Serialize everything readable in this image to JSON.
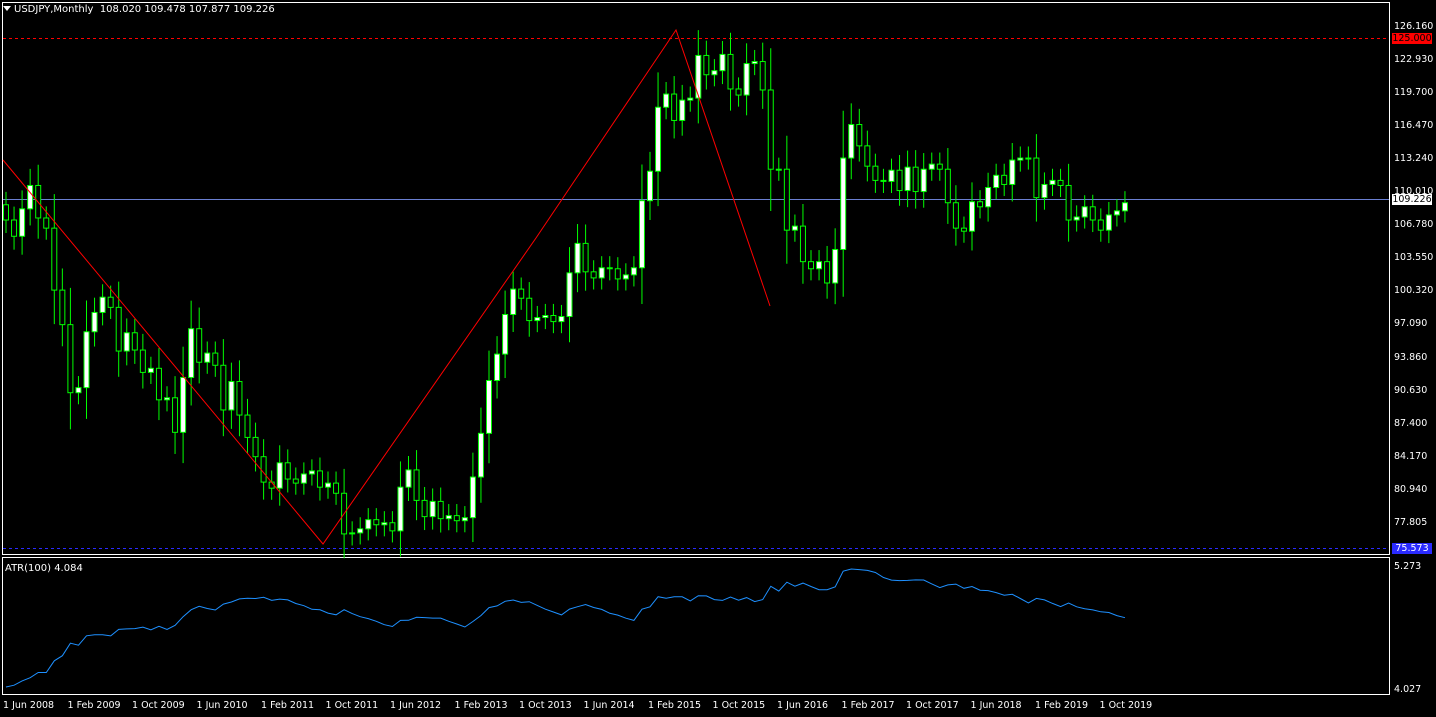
{
  "header": {
    "symbol_timeframe": "USDJPY,Monthly",
    "ohlc": "108.020 109.478 107.877 109.226"
  },
  "main_axis": {
    "ticks": [
      "126.160",
      "122.930",
      "119.700",
      "116.470",
      "113.240",
      "110.010",
      "106.780",
      "103.550",
      "100.320",
      "97.090",
      "93.860",
      "90.630",
      "87.400",
      "84.170",
      "80.940",
      "77.805"
    ]
  },
  "price_tags": {
    "upper_level": "125.000",
    "current": "109.226",
    "lower_level": "75.573"
  },
  "indicator": {
    "label": "ATR(100) 4.084",
    "ticks": [
      "5.273",
      "4.027"
    ]
  },
  "x_axis": {
    "labels": [
      "1 Jun 2008",
      "1 Feb 2009",
      "1 Oct 2009",
      "1 Jun 2010",
      "1 Feb 2011",
      "1 Oct 2011",
      "1 Jun 2012",
      "1 Feb 2013",
      "1 Oct 2013",
      "1 Jun 2014",
      "1 Feb 2015",
      "1 Oct 2015",
      "1 Jun 2016",
      "1 Feb 2017",
      "1 Oct 2017",
      "1 Jun 2018",
      "1 Feb 2019",
      "1 Oct 2019"
    ]
  },
  "colors": {
    "background": "#000000",
    "bull_candle": "#ffffff",
    "wick": "#00ff00",
    "bear_candle": "#000000",
    "zigzag": "#ff0000",
    "atr_line": "#1e90ff",
    "level_line": "#ff0000",
    "current_price_line": "#6a7fd1",
    "lower_level_line": "#2a2aff"
  },
  "chart_data": {
    "type": "candlestick",
    "title": "USDJPY,Monthly",
    "ylim": [
      76.0,
      126.5
    ],
    "series_close": [
      107.5,
      105.9,
      108.6,
      110.9,
      107.7,
      106.7,
      100.6,
      97.2,
      90.5,
      91.0,
      96.5,
      98.4,
      99.9,
      98.9,
      94.6,
      96.4,
      94.7,
      92.5,
      92.9,
      89.8,
      90.0,
      86.6,
      92.0,
      96.8,
      93.5,
      94.4,
      93.2,
      88.8,
      91.6,
      88.3,
      86.1,
      84.2,
      81.7,
      81.1,
      83.6,
      82.0,
      81.6,
      82.5,
      82.8,
      81.2,
      81.6,
      80.6,
      76.6,
      76.7,
      77.1,
      78.0,
      77.5,
      77.7,
      76.9,
      81.2,
      82.9,
      79.9,
      78.3,
      79.8,
      78.1,
      78.4,
      77.9,
      78.2,
      82.2,
      86.5,
      91.7,
      94.3,
      98.2,
      100.7,
      99.8,
      97.6,
      97.9,
      98.1,
      97.5,
      98.0,
      102.3,
      105.2,
      102.4,
      101.8,
      102.8,
      102.7,
      101.7,
      102.1,
      102.8,
      109.4,
      112.3,
      118.6,
      119.9,
      117.3,
      119.3,
      119.5,
      123.7,
      121.8,
      122.2,
      123.8,
      120.4,
      119.8,
      122.9,
      123.1,
      120.3,
      112.5,
      112.5,
      106.5,
      106.9,
      103.4,
      102.7,
      103.4,
      101.3,
      104.6,
      113.6,
      116.9,
      114.8,
      112.8,
      111.4,
      111.3,
      112.4,
      110.4,
      112.7,
      110.3,
      112.5,
      113.0,
      112.5,
      109.2,
      106.7,
      106.4,
      109.3,
      108.8,
      110.7,
      111.9,
      111.0,
      113.4,
      113.6,
      113.6,
      109.7,
      111.0,
      111.4,
      110.9,
      107.5,
      107.8,
      108.8,
      107.5,
      106.5,
      108.0,
      108.4,
      109.2
    ]
  }
}
